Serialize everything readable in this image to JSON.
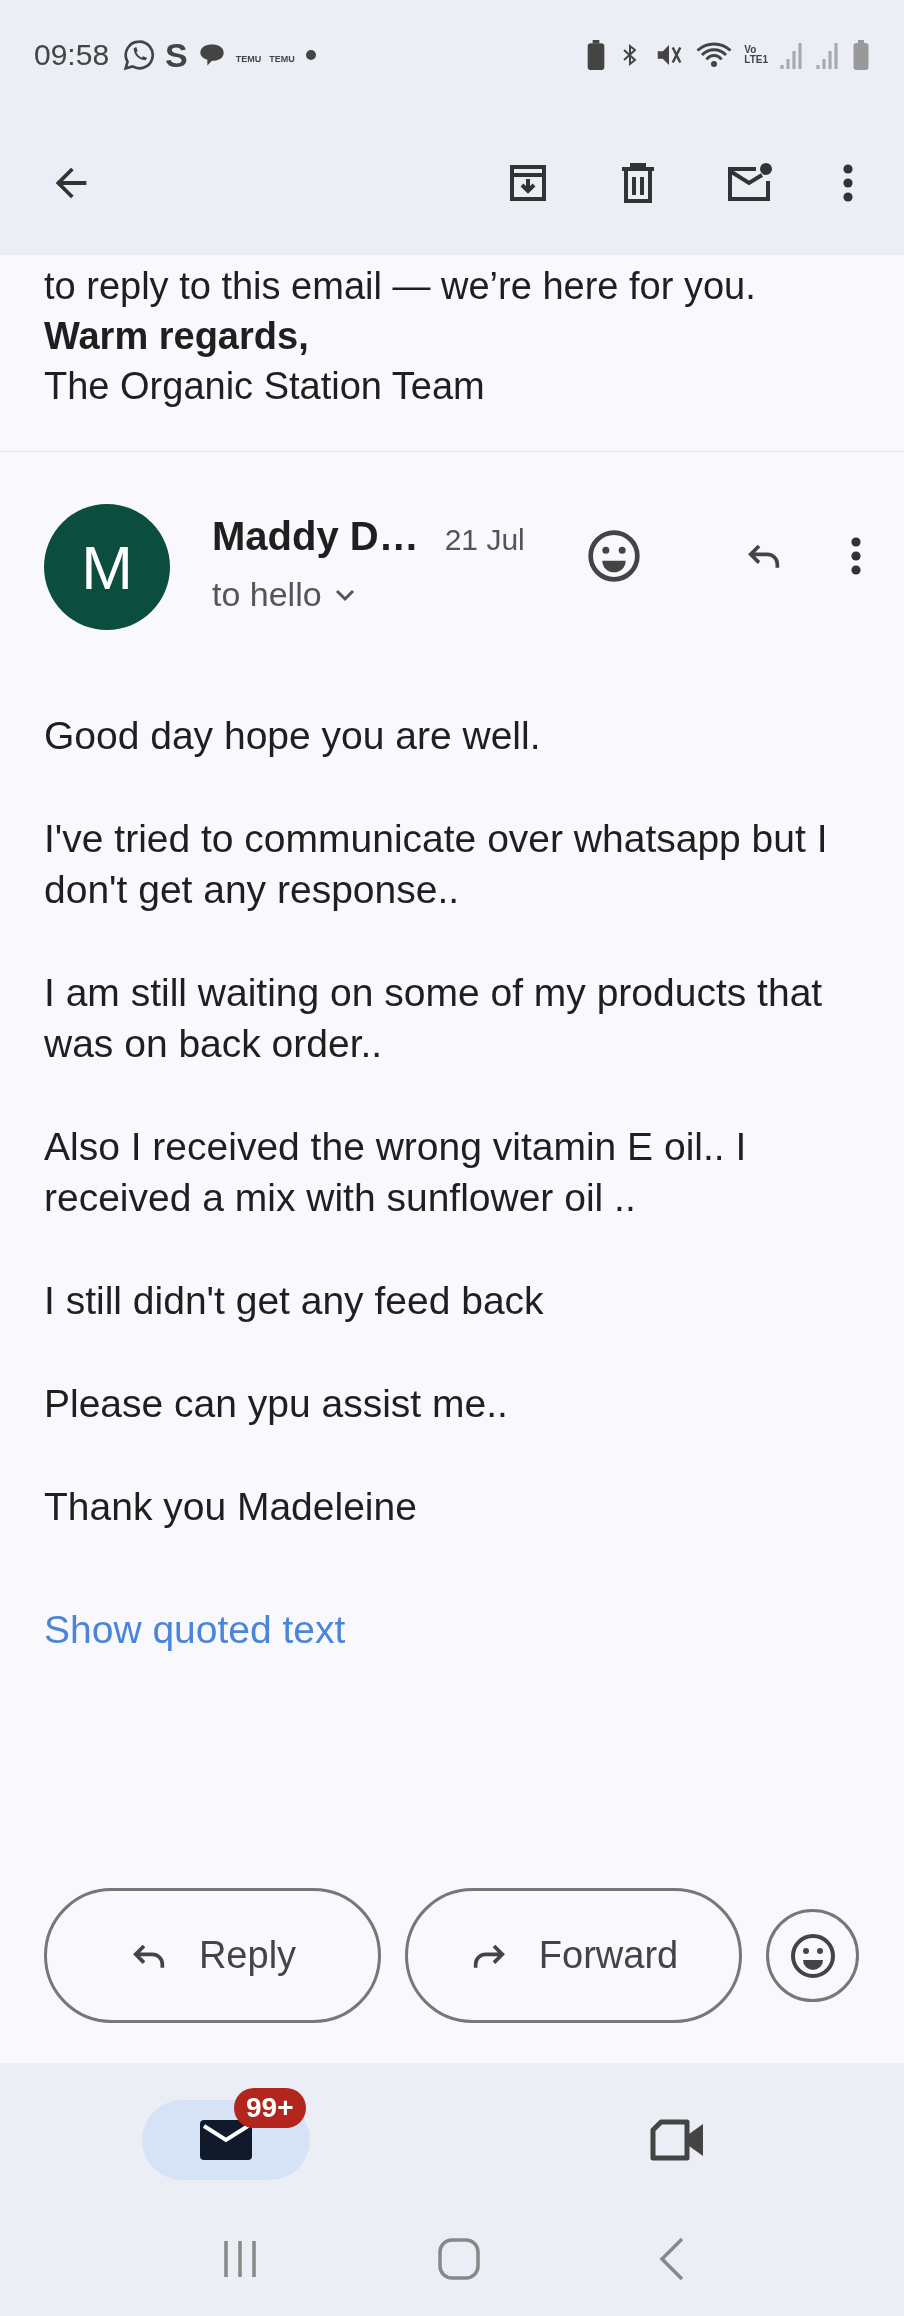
{
  "status_bar": {
    "time": "09:58",
    "app_letter": "S",
    "notification_labels": [
      "TEMU",
      "TEMU"
    ],
    "network_labels": [
      "Vo",
      "LTE1"
    ]
  },
  "previous_message": {
    "text_tail": "to reply to this email — we’re here for you.",
    "closing": "Warm regards,",
    "signature": "The Organic Station Team"
  },
  "message": {
    "avatar_letter": "M",
    "sender": "Maddy D…",
    "date": "21 Jul",
    "recipient": "to hello",
    "body": [
      "Good day hope you are well.",
      "I've tried to communicate over whatsapp but I don't get any response..",
      "I am still waiting on some of my products that was on back order..",
      "Also I received the wrong vitamin E oil.. I received a mix with sunflower oil ..",
      "I still didn't get any feed back",
      "Please can ypu assist me..",
      "Thank you Madeleine"
    ],
    "show_quoted": "Show quoted text"
  },
  "actions": [
    {
      "kind": "reply",
      "label": "Reply"
    },
    {
      "kind": "forward",
      "label": "Forward"
    }
  ],
  "bottom_nav": [
    {
      "kind": "mail",
      "selected": true,
      "badge": "99+"
    },
    {
      "kind": "meet",
      "selected": false
    }
  ]
}
